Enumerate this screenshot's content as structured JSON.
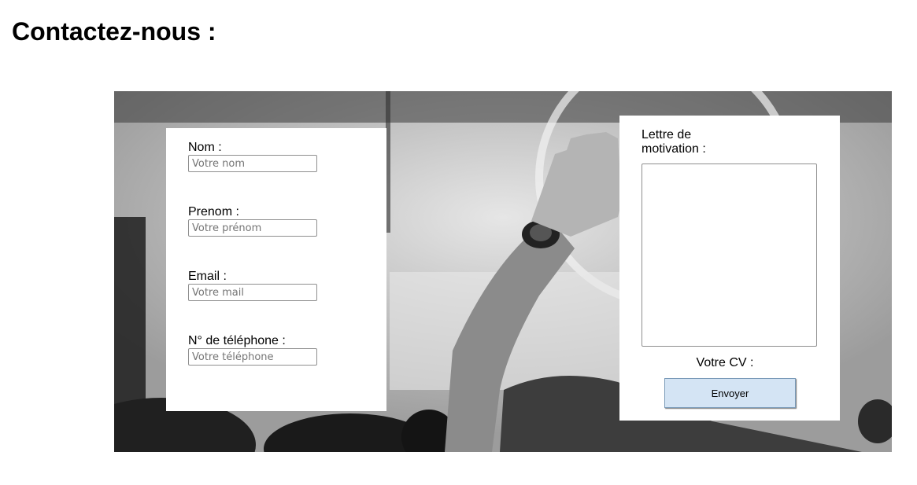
{
  "page": {
    "title": "Contactez-nous :"
  },
  "hero": {
    "image_description_icon": "raised-hand-photo"
  },
  "contact_form": {
    "nom": {
      "label": "Nom :",
      "placeholder": "Votre nom",
      "value": ""
    },
    "prenom": {
      "label": "Prenom :",
      "placeholder": "Votre prénom",
      "value": ""
    },
    "email": {
      "label": "Email :",
      "placeholder": "Votre mail",
      "value": ""
    },
    "telephone": {
      "label": "N° de téléphone :",
      "placeholder": "Votre téléphone",
      "value": ""
    }
  },
  "application_form": {
    "motivation_label_line1": "Lettre de",
    "motivation_label_line2": "motivation :",
    "motivation_value": "",
    "cv_label": "Votre CV :",
    "submit_label": "Envoyer"
  },
  "colors": {
    "button_bg": "#d4e4f4",
    "panel_bg": "#ffffff"
  }
}
